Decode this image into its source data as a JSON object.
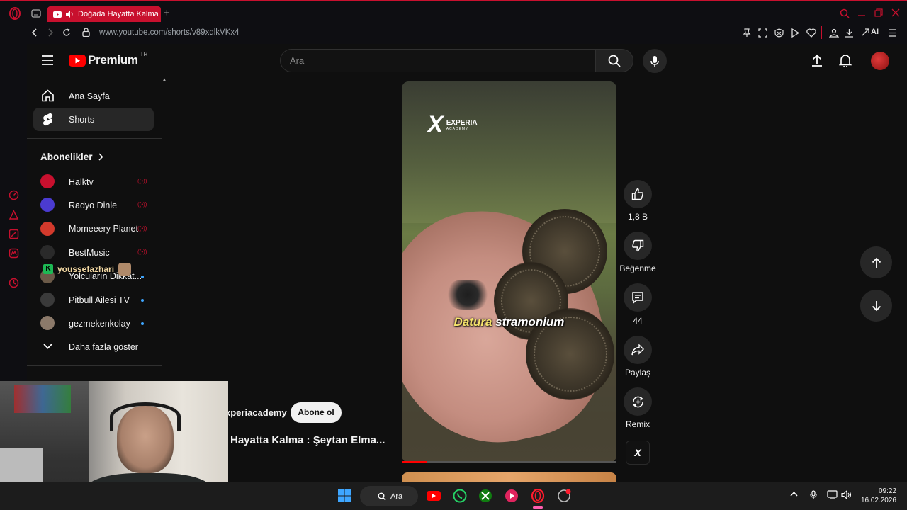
{
  "browser": {
    "tab_title": "Doğada Hayatta Kalma",
    "url": "www.youtube.com/shorts/v89xdlkVKx4",
    "ai_label": "AI"
  },
  "youtube": {
    "logo_text": "Premium",
    "region": "TR",
    "search_placeholder": "Ara"
  },
  "sidebar": {
    "home": "Ana Sayfa",
    "shorts": "Shorts",
    "subscriptions_header": "Abonelikler",
    "subscriptions": [
      {
        "name": "Halktv",
        "indicator": "live",
        "color": "#c8102e"
      },
      {
        "name": "Radyo Dinle",
        "indicator": "live",
        "color": "#4b3bd1"
      },
      {
        "name": "Momeeery Planet",
        "indicator": "live",
        "color": "#d33a2c"
      },
      {
        "name": "BestMusic",
        "indicator": "live",
        "color": "#2a2a2a"
      },
      {
        "name": "Yolcuların Dikkat...",
        "indicator": "new",
        "color": "#6b5a48"
      },
      {
        "name": "Pitbull Ailesi TV",
        "indicator": "new",
        "color": "#3a3a3a"
      },
      {
        "name": "gezmekenkolay",
        "indicator": "new",
        "color": "#8c7a6a"
      }
    ],
    "show_more": "Daha fazla göster"
  },
  "overlay_username": "youssefazhari",
  "video": {
    "brand_name": "EXPERIA",
    "brand_sub": "ACADEMY",
    "caption_highlight": "Datura",
    "caption_rest": " stramonium",
    "channel": "xperiacademy",
    "subscribe_label": "Abone ol",
    "title": "Hayatta Kalma : Şeytan Elma...",
    "progress": 0.12
  },
  "actions": {
    "likes": "1,8 B",
    "dislike": "Beğenme",
    "comments": "44",
    "share": "Paylaş",
    "remix": "Remix"
  },
  "taskbar": {
    "search_label": "Ara",
    "time": "09:22",
    "date": "16.02.2026"
  }
}
